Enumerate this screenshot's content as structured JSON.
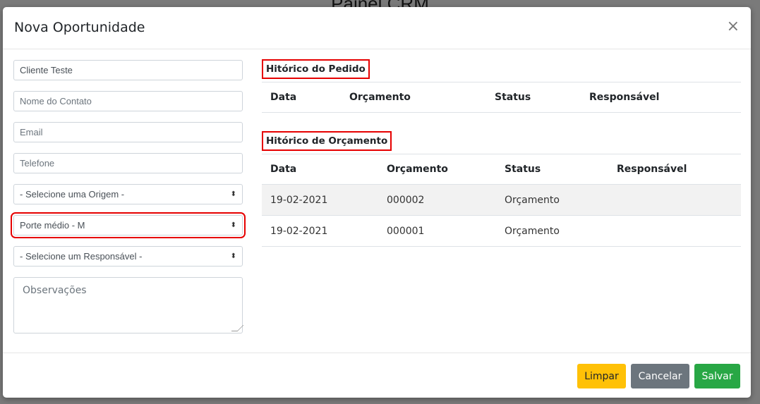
{
  "backdrop": {
    "title": "Painel CRM"
  },
  "modal": {
    "title": "Nova Oportunidade",
    "close_glyph": "×"
  },
  "form": {
    "client": {
      "value": "Cliente Teste"
    },
    "contact": {
      "placeholder": "Nome do Contato"
    },
    "email": {
      "placeholder": "Email"
    },
    "phone": {
      "placeholder": "Telefone"
    },
    "origin": {
      "selected": "- Selecione uma Origem -"
    },
    "size": {
      "selected": "Porte médio - M"
    },
    "responsible": {
      "selected": "- Selecione um Responsável -"
    },
    "notes": {
      "placeholder": "Observações"
    }
  },
  "order_history": {
    "title": "Hitórico do Pedido",
    "columns": [
      "Data",
      "Orçamento",
      "Status",
      "Responsável"
    ]
  },
  "quote_history": {
    "title": "Hitórico de Orçamento",
    "columns": [
      "Data",
      "Orçamento",
      "Status",
      "Responsável"
    ],
    "rows": [
      {
        "data": "19-02-2021",
        "orcamento": "000002",
        "status": "Orçamento",
        "responsavel": ""
      },
      {
        "data": "19-02-2021",
        "orcamento": "000001",
        "status": "Orçamento",
        "responsavel": ""
      }
    ]
  },
  "footer": {
    "clear_label": "Limpar",
    "cancel_label": "Cancelar",
    "save_label": "Salvar"
  },
  "colors": {
    "highlight": "#e60000",
    "clear": "#ffc107",
    "cancel": "#6c757d",
    "save": "#28a745"
  }
}
